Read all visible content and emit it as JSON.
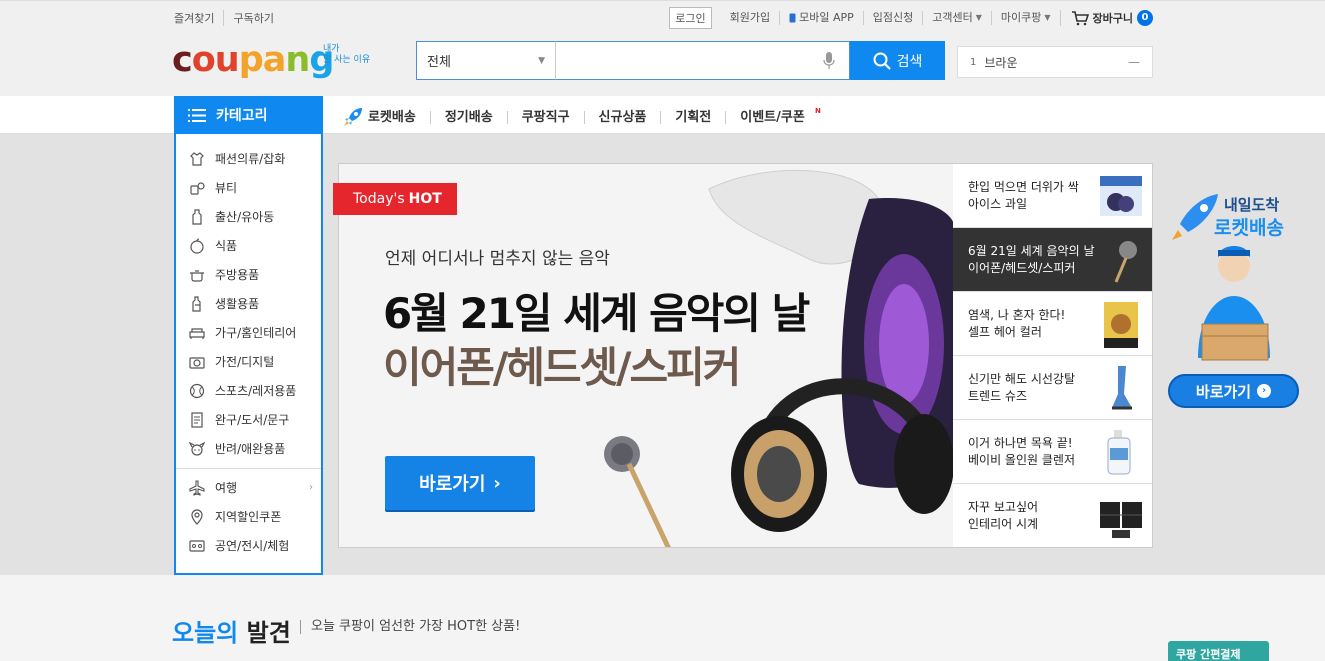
{
  "topbar": {
    "left": [
      "즐겨찾기",
      "구독하기"
    ],
    "login": "로그인",
    "signup": "회원가입",
    "mobile_app": "모바일 APP",
    "seller": "입점신청",
    "customer_center": "고객센터",
    "my_coupang": "마이쿠팡",
    "cart_label": "장바구니",
    "cart_count": "0"
  },
  "header": {
    "logo": {
      "c1": "c",
      "c2": "ou",
      "c3": "pa",
      "c4": "n",
      "c5": "g"
    },
    "logo_tag_1": "내가",
    "logo_tag_2": "할 사는 이유",
    "search_scope": "전체",
    "search_input_value": "",
    "search_button": "검색",
    "rank_number": "1",
    "rank_keyword": "브라운"
  },
  "nav": {
    "category_button": "카테고리",
    "items": [
      "로켓배송",
      "정기배송",
      "쿠팡직구",
      "신규상품",
      "기획전",
      "이벤트/쿠폰"
    ],
    "new_badge": "N"
  },
  "category_menu": {
    "items": [
      "패션의류/잡화",
      "뷰티",
      "출산/유아동",
      "식품",
      "주방용품",
      "생활용품",
      "가구/홈인테리어",
      "가전/디지털",
      "스포츠/레저용품",
      "완구/도서/문구",
      "반려/애완용품"
    ],
    "extra": [
      "여행",
      "지역할인쿠폰",
      "공연/전시/체험"
    ]
  },
  "banner": {
    "tag_prefix": "Today's",
    "tag_hot": "HOT",
    "subtitle": "언제 어디서나 멈추지 않는 음악",
    "title_1": "6월 21일 세계 음악의 날",
    "title_2": "이어폰/헤드셋/스피커",
    "cta": "바로가기"
  },
  "side_list": [
    {
      "line1": "한입 먹으면 더위가 싹",
      "line2": "아이스 과일"
    },
    {
      "line1": "6월 21일 세계 음악의 날",
      "line2": "이어폰/헤드셋/스피커"
    },
    {
      "line1": "염색, 나 혼자 한다!",
      "line2": "셀프 헤어 컬러"
    },
    {
      "line1": "신기만 해도 시선강탈",
      "line2": "트렌드 슈즈"
    },
    {
      "line1": "이거 하나면 목욕 끝!",
      "line2": "베이비 올인원 클렌저"
    },
    {
      "line1": "자꾸 보고싶어",
      "line2": "인테리어 시계"
    }
  ],
  "rocket_ad": {
    "line1": "내일도착",
    "line2": "로켓배송",
    "cta": "바로가기"
  },
  "discover": {
    "title_blue": "오늘의",
    "title_dark": "발견",
    "subtitle": "오늘 쿠팡이 엄선한 가장 HOT한 상품!",
    "pay_box": "쿠팡 간편결제"
  },
  "colors": {
    "accent": "#0f89f0",
    "hot_red": "#e5262c",
    "band_bg": "#e2e2e2"
  }
}
